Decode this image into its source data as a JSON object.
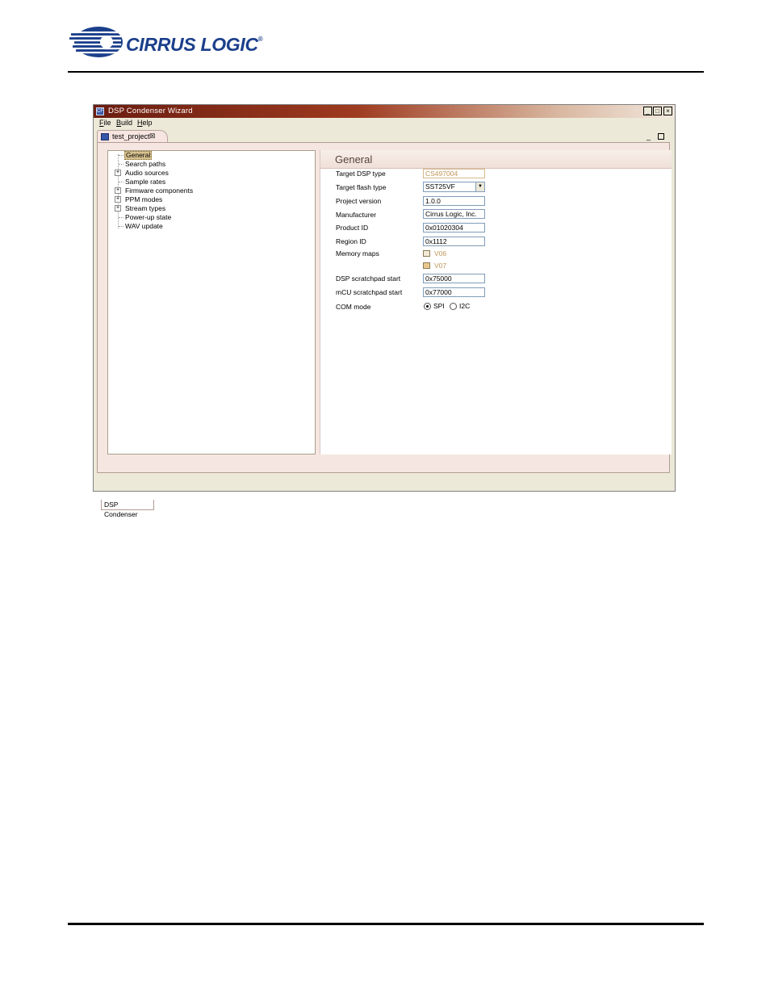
{
  "document": {
    "logo_text": "CIRRUS LOGIC",
    "logo_mark": "®"
  },
  "window": {
    "title": "DSP Condenser Wizard",
    "app_icon": "CF",
    "controls": [
      "_",
      "□",
      "×"
    ],
    "menu": [
      "File",
      "Build",
      "Help"
    ],
    "editor_tab": {
      "label": "test_project",
      "close": "⊠"
    },
    "view_controls": {
      "minimize": "_",
      "maximize": ""
    },
    "tree": [
      {
        "label": "General",
        "selected": true,
        "expandable": false
      },
      {
        "label": "Search paths",
        "selected": false,
        "expandable": false
      },
      {
        "label": "Audio sources",
        "selected": false,
        "expandable": true
      },
      {
        "label": "Sample rates",
        "selected": false,
        "expandable": false
      },
      {
        "label": "Firmware components",
        "selected": false,
        "expandable": true
      },
      {
        "label": "PPM modes",
        "selected": false,
        "expandable": true
      },
      {
        "label": "Stream types",
        "selected": false,
        "expandable": true
      },
      {
        "label": "Power-up state",
        "selected": false,
        "expandable": false
      },
      {
        "label": "WAV update",
        "selected": false,
        "expandable": false
      }
    ],
    "expand_glyph": "+",
    "form": {
      "title": "General",
      "target_dsp_type": {
        "label": "Target DSP type",
        "value": "CS497004"
      },
      "target_flash_type": {
        "label": "Target flash type",
        "value": "SST25VF",
        "arrow": "▼"
      },
      "project_version": {
        "label": "Project version",
        "value": "1.0.0"
      },
      "manufacturer": {
        "label": "Manufacturer",
        "value": "Cirrus Logic, Inc."
      },
      "product_id": {
        "label": "Product ID",
        "value": "0x01020304"
      },
      "region_id": {
        "label": "Region ID",
        "value": "0x1112"
      },
      "memory_maps": {
        "label": "Memory maps",
        "items": [
          {
            "label": "V06",
            "checked": false
          },
          {
            "label": "V07",
            "checked": true
          }
        ]
      },
      "dsp_scratchpad_start": {
        "label": "DSP scratchpad start",
        "value": "0x75000"
      },
      "mcu_scratchpad_start": {
        "label": "mCU scratchpad start",
        "value": "0x77000"
      },
      "com_mode": {
        "label": "COM mode",
        "options": [
          {
            "label": "SPI",
            "selected": true
          },
          {
            "label": "I2C",
            "selected": false
          }
        ]
      }
    },
    "bottom_tab": "DSP Condenser"
  }
}
